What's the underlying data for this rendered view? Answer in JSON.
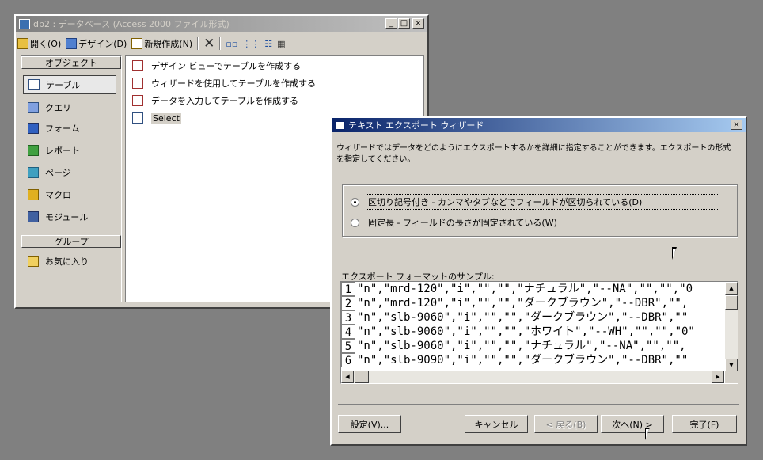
{
  "db_window": {
    "title": "db2 : データベース (Access 2000 ファイル形式)",
    "toolbar": {
      "open": "開く(O)",
      "design": "デザイン(D)",
      "new": "新規作成(N)"
    },
    "objects_header": "オブジェクト",
    "objects": [
      "テーブル",
      "クエリ",
      "フォーム",
      "レポート",
      "ページ",
      "マクロ",
      "モジュール"
    ],
    "groups_header": "グループ",
    "favorites": "お気に入り",
    "items": [
      "デザイン ビューでテーブルを作成する",
      "ウィザードを使用してテーブルを作成する",
      "データを入力してテーブルを作成する",
      "Select"
    ]
  },
  "wizard": {
    "title": "テキスト エクスポート ウィザード",
    "description": "ウィザードではデータをどのようにエクスポートするかを詳細に指定することができます。エクスポートの形式を指定してください。",
    "option_delimited": "区切り記号付き - カンマやタブなどでフィールドが区切られている(D)",
    "option_fixed": "固定長 - フィールドの長さが固定されている(W)",
    "sample_label": "エクスポート フォーマットのサンプル:",
    "sample_rows": [
      {
        "num": "1",
        "text": "\"n\",\"mrd-120\",\"i\",\"\",\"\",\"ナチュラル\",\"--NA\",\"\",\"\",\"0"
      },
      {
        "num": "2",
        "text": "\"n\",\"mrd-120\",\"i\",\"\",\"\",\"ダークブラウン\",\"--DBR\",\"\","
      },
      {
        "num": "3",
        "text": "\"n\",\"slb-9060\",\"i\",\"\",\"\",\"ダークブラウン\",\"--DBR\",\"\""
      },
      {
        "num": "4",
        "text": "\"n\",\"slb-9060\",\"i\",\"\",\"\",\"ホワイト\",\"--WH\",\"\",\"\",\"0\""
      },
      {
        "num": "5",
        "text": "\"n\",\"slb-9060\",\"i\",\"\",\"\",\"ナチュラル\",\"--NA\",\"\",\"\","
      },
      {
        "num": "6",
        "text": "\"n\",\"slb-9090\",\"i\",\"\",\"\",\"ダークブラウン\",\"--DBR\",\"\""
      }
    ],
    "buttons": {
      "settings": "設定(V)...",
      "cancel": "キャンセル",
      "back": "< 戻る(B)",
      "next": "次へ(N) >",
      "finish": "完了(F)"
    }
  },
  "colors": {
    "desktop": "#808080",
    "active_title_start": "#0a246a",
    "active_title_end": "#a6caf0",
    "inactive_title_start": "#808080",
    "inactive_title_end": "#c0c0c0",
    "face": "#d4d0c8"
  }
}
